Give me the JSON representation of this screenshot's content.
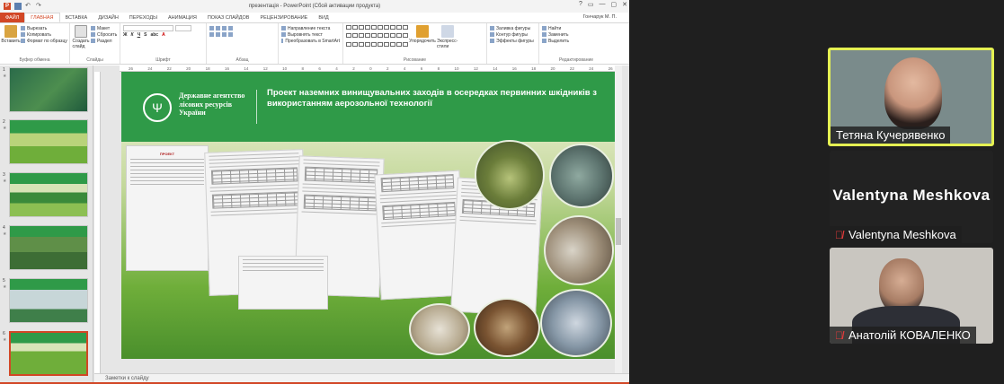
{
  "window": {
    "title": "презентація - PowerPoint (Сбой активации продукта)",
    "user": "Гончарук М. П.",
    "controls": [
      "?",
      "▭",
      "—",
      "▢",
      "✕"
    ]
  },
  "tabs": [
    {
      "label": "ФАЙЛ",
      "type": "file"
    },
    {
      "label": "ГЛАВНАЯ",
      "type": "active"
    },
    {
      "label": "ВСТАВКА"
    },
    {
      "label": "ДИЗАЙН"
    },
    {
      "label": "ПЕРЕХОДЫ"
    },
    {
      "label": "АНИМАЦИЯ"
    },
    {
      "label": "ПОКАЗ СЛАЙДОВ"
    },
    {
      "label": "РЕЦЕНЗИРОВАНИЕ"
    },
    {
      "label": "ВИД"
    }
  ],
  "ribbon": {
    "clipboard": {
      "paste": "Вставить",
      "cut": "Вырезать",
      "copy": "Копировать",
      "format": "Формат по образцу",
      "label": "Буфер обмена"
    },
    "slides": {
      "new": "Создать слайд",
      "layout": "Макет",
      "reset": "Сбросить",
      "section": "Раздел",
      "label": "Слайды"
    },
    "font": {
      "label": "Шрифт"
    },
    "paragraph": {
      "direction": "Направление текста",
      "align": "Выровнять текст",
      "smartart": "Преобразовать в SmartArt",
      "label": "Абзац"
    },
    "drawing": {
      "arrange": "Упорядочить",
      "styles": "Экспресс-стили",
      "fill": "Заливка фигуры",
      "outline": "Контур фигуры",
      "effects": "Эффекты фигуры",
      "label": "Рисование"
    },
    "editing": {
      "find": "Найти",
      "replace": "Заменить",
      "select": "Выделить",
      "label": "Редактирование"
    }
  },
  "ruler": [
    "26",
    "24",
    "22",
    "20",
    "18",
    "16",
    "14",
    "12",
    "10",
    "8",
    "6",
    "4",
    "2",
    "0",
    "2",
    "4",
    "6",
    "8",
    "10",
    "12",
    "14",
    "16",
    "18",
    "20",
    "22",
    "24",
    "26"
  ],
  "thumbnails": [
    {
      "num": "1",
      "star": "★"
    },
    {
      "num": "2",
      "star": "★"
    },
    {
      "num": "3",
      "star": "★"
    },
    {
      "num": "4",
      "star": "★"
    },
    {
      "num": "5",
      "star": "★"
    },
    {
      "num": "6",
      "star": "★"
    }
  ],
  "slide": {
    "agency": "Державне агентство лісових ресурсів України",
    "title": "Проект  наземних винищувальних заходів в осередках  первинних шкідників з використанням аерозольної технології",
    "doc_heading": "ПРОЕКТ"
  },
  "notes": "Заметки к слайду",
  "participants": [
    {
      "name": "Тетяна Кучерявенко",
      "muted": false
    },
    {
      "name": "Valentyna Meshkova",
      "display": "Valentyna  Meshkova",
      "muted": true
    },
    {
      "name": "Анатолій КОВАЛЕНКО",
      "muted": true
    }
  ],
  "colors": {
    "accent": "#d24726",
    "slide_green": "#2f9a48",
    "active_speaker": "#e5f152"
  }
}
